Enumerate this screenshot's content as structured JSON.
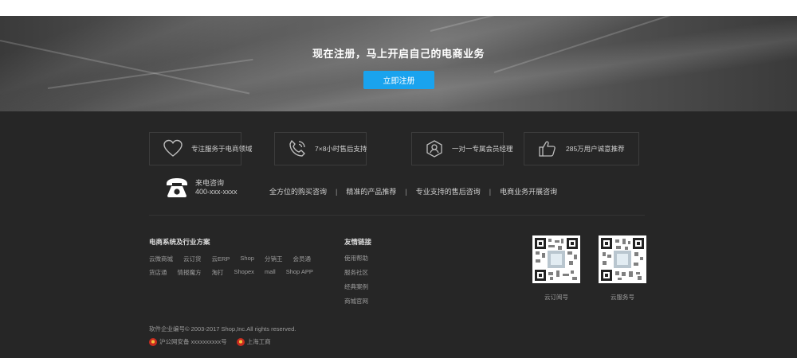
{
  "hero": {
    "title": "现在注册，马上开启自己的电商业务",
    "button_label": "立即注册"
  },
  "features": [
    {
      "icon": "heart-icon",
      "label": "专注服务于电商领域"
    },
    {
      "icon": "phone-call-icon",
      "label": "7×8小时售后支持"
    },
    {
      "icon": "user-shield-icon",
      "label": "一对一专属会员经理"
    },
    {
      "icon": "thumbs-up-icon",
      "label": "285万用户诚意推荐"
    }
  ],
  "hotline": {
    "label": "来电咨询",
    "number": "400-xxx-xxxx"
  },
  "consult_links": [
    "全方位的购买咨询",
    "精准的产品推荐",
    "专业支持的售后咨询",
    "电商业务开展咨询"
  ],
  "solutions": {
    "title": "电商系统及行业方案",
    "row1": [
      "云微商城",
      "云订货",
      "云ERP",
      "Shop",
      "分销王",
      "会员通"
    ],
    "row2": [
      "货店通",
      "情报魔方",
      "淘打",
      "Shopex",
      "mall",
      "Shop APP"
    ]
  },
  "friends": {
    "title": "友情链接",
    "links": [
      "使用帮助",
      "服务社区",
      "经典案例",
      "商城官网"
    ]
  },
  "qrcodes": [
    {
      "label": "云订阅号"
    },
    {
      "label": "云服务号"
    }
  ],
  "footer": {
    "copyright": "软件企业编号© 2003-2017 Shop,Inc.All rights reserved.",
    "badge1": "沪公网安备 xxxxxxxxxx号",
    "badge2": "上海工商"
  },
  "colors": {
    "accent": "#1aa3ee",
    "background": "#262626"
  }
}
